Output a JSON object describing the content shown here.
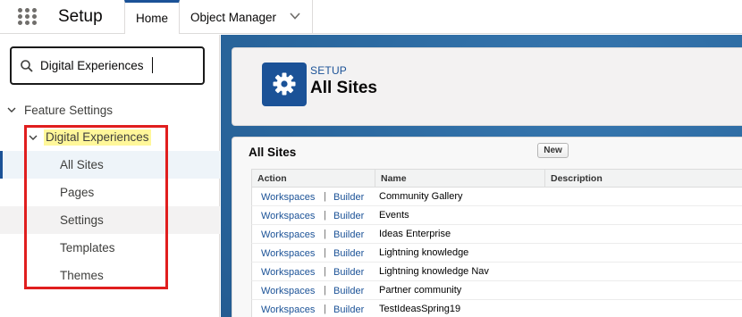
{
  "topbar": {
    "app_title": "Setup",
    "tabs": [
      {
        "label": "Home",
        "active": true
      },
      {
        "label": "Object Manager",
        "has_dropdown": true
      }
    ]
  },
  "sidebar": {
    "search": {
      "value": "Digital Experiences",
      "icon": "search-icon"
    },
    "feature_settings_label": "Feature Settings",
    "digital_experiences_label": "Digital Experiences",
    "items": [
      {
        "label": "All Sites",
        "selected": true
      },
      {
        "label": "Pages"
      },
      {
        "label": "Settings"
      },
      {
        "label": "Templates"
      },
      {
        "label": "Themes"
      }
    ]
  },
  "header": {
    "eyebrow": "SETUP",
    "title": "All Sites",
    "icon": "gear-icon"
  },
  "sites": {
    "title": "All Sites",
    "new_label": "New",
    "columns": [
      "Action",
      "Name",
      "Description"
    ],
    "action_workspaces": "Workspaces",
    "action_separator": "|",
    "action_builder": "Builder",
    "rows": [
      {
        "name": "Community Gallery"
      },
      {
        "name": "Events"
      },
      {
        "name": "Ideas Enterprise"
      },
      {
        "name": "Lightning knowledge"
      },
      {
        "name": "Lightning knowledge Nav"
      },
      {
        "name": "Partner community"
      },
      {
        "name": "TestIdeasSpring19"
      }
    ]
  },
  "colors": {
    "brand_blue": "#1b5297",
    "highlight_yellow": "#fff79a",
    "annotation_red": "#e01e1e",
    "background_blue": "#2f6ea5"
  }
}
